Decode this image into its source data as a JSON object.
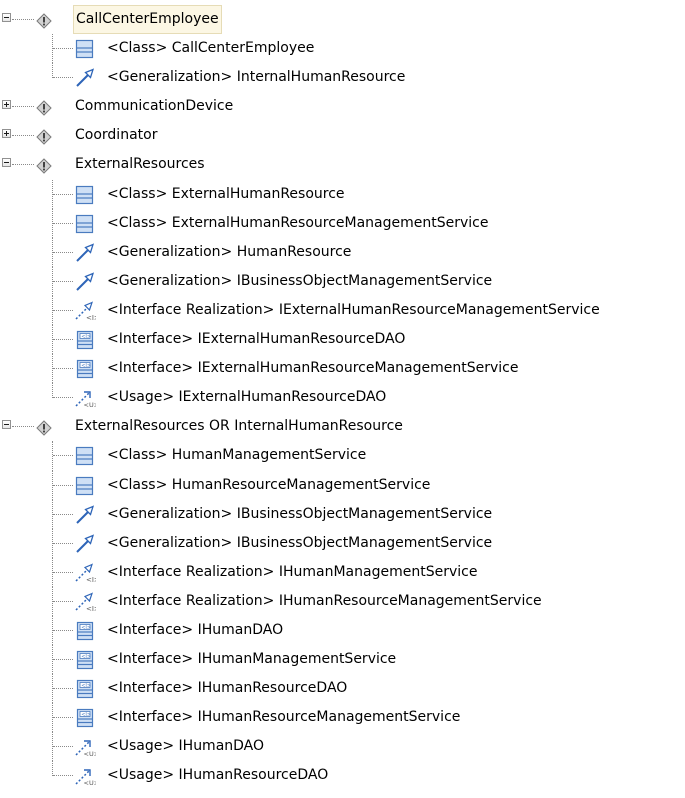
{
  "tree": {
    "groups": [
      {
        "label": "CallCenterEmployee",
        "expanded": true,
        "selected": true,
        "children": [
          {
            "icon": "class-icon",
            "label": "<Class> CallCenterEmployee"
          },
          {
            "icon": "generalization-icon",
            "label": "<Generalization> InternalHumanResource"
          }
        ]
      },
      {
        "label": "CommunicationDevice",
        "expanded": false,
        "children": []
      },
      {
        "label": "Coordinator",
        "expanded": false,
        "children": []
      },
      {
        "label": "ExternalResources",
        "expanded": true,
        "children": [
          {
            "icon": "class-icon",
            "label": "<Class> ExternalHumanResource"
          },
          {
            "icon": "class-icon",
            "label": "<Class> ExternalHumanResourceManagementService"
          },
          {
            "icon": "generalization-icon",
            "label": "<Generalization> HumanResource"
          },
          {
            "icon": "generalization-icon",
            "label": "<Generalization> IBusinessObjectManagementService"
          },
          {
            "icon": "interface-realization-icon",
            "label": "<Interface Realization> IExternalHumanResourceManagementService"
          },
          {
            "icon": "interface-icon",
            "label": "<Interface> IExternalHumanResourceDAO"
          },
          {
            "icon": "interface-icon",
            "label": "<Interface> IExternalHumanResourceManagementService"
          },
          {
            "icon": "usage-icon",
            "label": "<Usage> IExternalHumanResourceDAO"
          }
        ]
      },
      {
        "label": "ExternalResources OR InternalHumanResource",
        "expanded": true,
        "children": [
          {
            "icon": "class-icon",
            "label": "<Class> HumanManagementService"
          },
          {
            "icon": "class-icon",
            "label": "<Class> HumanResourceManagementService"
          },
          {
            "icon": "generalization-icon",
            "label": "<Generalization> IBusinessObjectManagementService"
          },
          {
            "icon": "generalization-icon",
            "label": "<Generalization> IBusinessObjectManagementService"
          },
          {
            "icon": "interface-realization-icon",
            "label": "<Interface Realization> IHumanManagementService"
          },
          {
            "icon": "interface-realization-icon",
            "label": "<Interface Realization> IHumanResourceManagementService"
          },
          {
            "icon": "interface-icon",
            "label": "<Interface> IHumanDAO"
          },
          {
            "icon": "interface-icon",
            "label": "<Interface> IHumanManagementService"
          },
          {
            "icon": "interface-icon",
            "label": "<Interface> IHumanResourceDAO"
          },
          {
            "icon": "interface-icon",
            "label": "<Interface> IHumanResourceManagementService"
          },
          {
            "icon": "usage-icon",
            "label": "<Usage> IHumanDAO"
          },
          {
            "icon": "usage-icon",
            "label": "<Usage> IHumanResourceDAO"
          }
        ]
      }
    ]
  },
  "colors": {
    "class_fill": "#cfe0f5",
    "class_stroke": "#4a7bbf",
    "arrow": "#2e65b8",
    "warning_fill": "#d2d2d2",
    "warning_stroke": "#7a7a7a",
    "selection_bg": "#fcf7e4"
  }
}
